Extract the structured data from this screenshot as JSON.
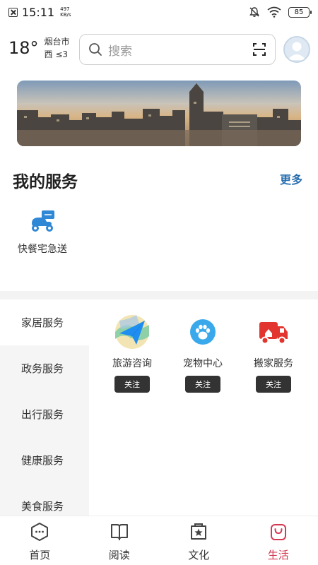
{
  "status_bar": {
    "time": "15:11",
    "net_speed_value": "497",
    "net_speed_unit": "KB/s",
    "battery": "85"
  },
  "header": {
    "temperature": "18°",
    "city": "烟台市",
    "wind": "西 ≤3",
    "search_placeholder": "搜索"
  },
  "my_services": {
    "title": "我的服务",
    "more_label": "更多",
    "items": [
      {
        "label": "快餐宅急送",
        "icon": "scooter-icon"
      }
    ]
  },
  "categories": [
    {
      "label": "家居服务",
      "active": true
    },
    {
      "label": "政务服务",
      "active": false
    },
    {
      "label": "出行服务",
      "active": false
    },
    {
      "label": "健康服务",
      "active": false
    },
    {
      "label": "美食服务",
      "active": false
    }
  ],
  "category_services": [
    {
      "name": "旅游咨询",
      "follow_label": "关注",
      "icon": "paper-plane-map-icon"
    },
    {
      "name": "宠物中心",
      "follow_label": "关注",
      "icon": "paw-icon"
    },
    {
      "name": "搬家服务",
      "follow_label": "关注",
      "icon": "moving-truck-icon"
    }
  ],
  "bottom_nav": [
    {
      "label": "首页",
      "icon": "home-icon",
      "active": false
    },
    {
      "label": "阅读",
      "icon": "book-icon",
      "active": false
    },
    {
      "label": "文化",
      "icon": "culture-icon",
      "active": false
    },
    {
      "label": "生活",
      "icon": "bag-icon",
      "active": true
    }
  ],
  "colors": {
    "accent_blue": "#2a6fb0",
    "active_nav": "#d33a52",
    "follow_button": "#333333"
  }
}
